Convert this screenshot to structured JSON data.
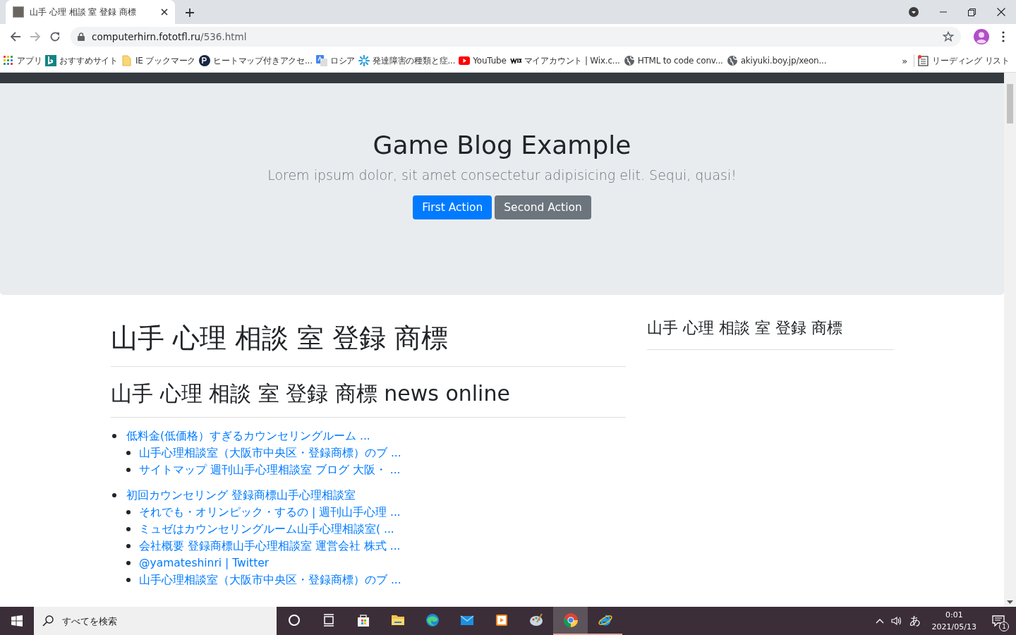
{
  "browser": {
    "tab": {
      "title": "山手 心理 相談 室 登録 商標",
      "selected": true
    },
    "address": {
      "host": "computerhirn.fototfl.ru",
      "path": "/536.html"
    },
    "bookmarks": [
      {
        "kind": "apps",
        "label": "アプリ"
      },
      {
        "kind": "bing",
        "label": "おすすめサイト"
      },
      {
        "kind": "folder",
        "label": "IE ブックマーク"
      },
      {
        "kind": "pt",
        "label": "ヒートマップ付きアクセ..."
      },
      {
        "kind": "translate",
        "label": "ロシア"
      },
      {
        "kind": "flower",
        "label": "発達障害の種類と症..."
      },
      {
        "kind": "youtube",
        "label": "YouTube"
      },
      {
        "kind": "wix",
        "label": "マイアカウント | Wix.c..."
      },
      {
        "kind": "globe",
        "label": "HTML to code conv..."
      },
      {
        "kind": "globe",
        "label": "akiyuki.boy.jp/xeon..."
      }
    ],
    "overflow": "»",
    "reading_list": "リーディング リスト"
  },
  "hero": {
    "title": "Game Blog Example",
    "subtitle": "Lorem ipsum dolor, sit amet consectetur adipisicing elit. Sequi, quasi!",
    "buttons": [
      {
        "label": "First Action",
        "kind": "primary"
      },
      {
        "label": "Second Action",
        "kind": "secondary"
      }
    ]
  },
  "main": {
    "heading": "山手 心理 相談 室 登録 商標",
    "subheading": "山手 心理 相談 室 登録 商標 news online",
    "list": [
      {
        "label": "低料金(低価格）すぎるカウンセリングルーム ...",
        "children": [
          {
            "label": "山手心理相談室（大阪市中央区・登録商標）のブ ..."
          },
          {
            "label": "サイトマップ 週刊山手心理相談室 ブログ 大阪・ ..."
          }
        ]
      },
      {
        "label": "初回カウンセリング 登録商標山手心理相談室",
        "children": [
          {
            "label": "それでも・オリンピック・するの | 週刊山手心理 ..."
          },
          {
            "label": "ミュゼはカウンセリングルーム山手心理相談室( ..."
          },
          {
            "label": "会社概要 登録商標山手心理相談室 運営会社 株式 ..."
          },
          {
            "label": "@yamateshinri | Twitter"
          },
          {
            "label": "山手心理相談室（大阪市中央区・登録商標）のブ ..."
          }
        ]
      }
    ]
  },
  "sidebar": {
    "heading": "山手 心理 相談 室 登録 商標"
  },
  "taskbar": {
    "search": {
      "placeholder": "すべてを検索"
    },
    "apps": [
      {
        "kind": "cortana",
        "selected": false,
        "running": false
      },
      {
        "kind": "taskview",
        "selected": false,
        "running": false
      },
      {
        "kind": "store",
        "selected": false,
        "running": false
      },
      {
        "kind": "explorer",
        "selected": false,
        "running": false
      },
      {
        "kind": "edge",
        "selected": false,
        "running": false
      },
      {
        "kind": "mail",
        "selected": false,
        "running": false
      },
      {
        "kind": "media",
        "selected": false,
        "running": false
      },
      {
        "kind": "paint",
        "selected": false,
        "running": false
      },
      {
        "kind": "chrome",
        "selected": true,
        "running": true
      },
      {
        "kind": "ie",
        "selected": false,
        "running": true
      }
    ],
    "ime": "あ",
    "time": "0:01",
    "date": "2021/05/13",
    "notifications": "1"
  }
}
